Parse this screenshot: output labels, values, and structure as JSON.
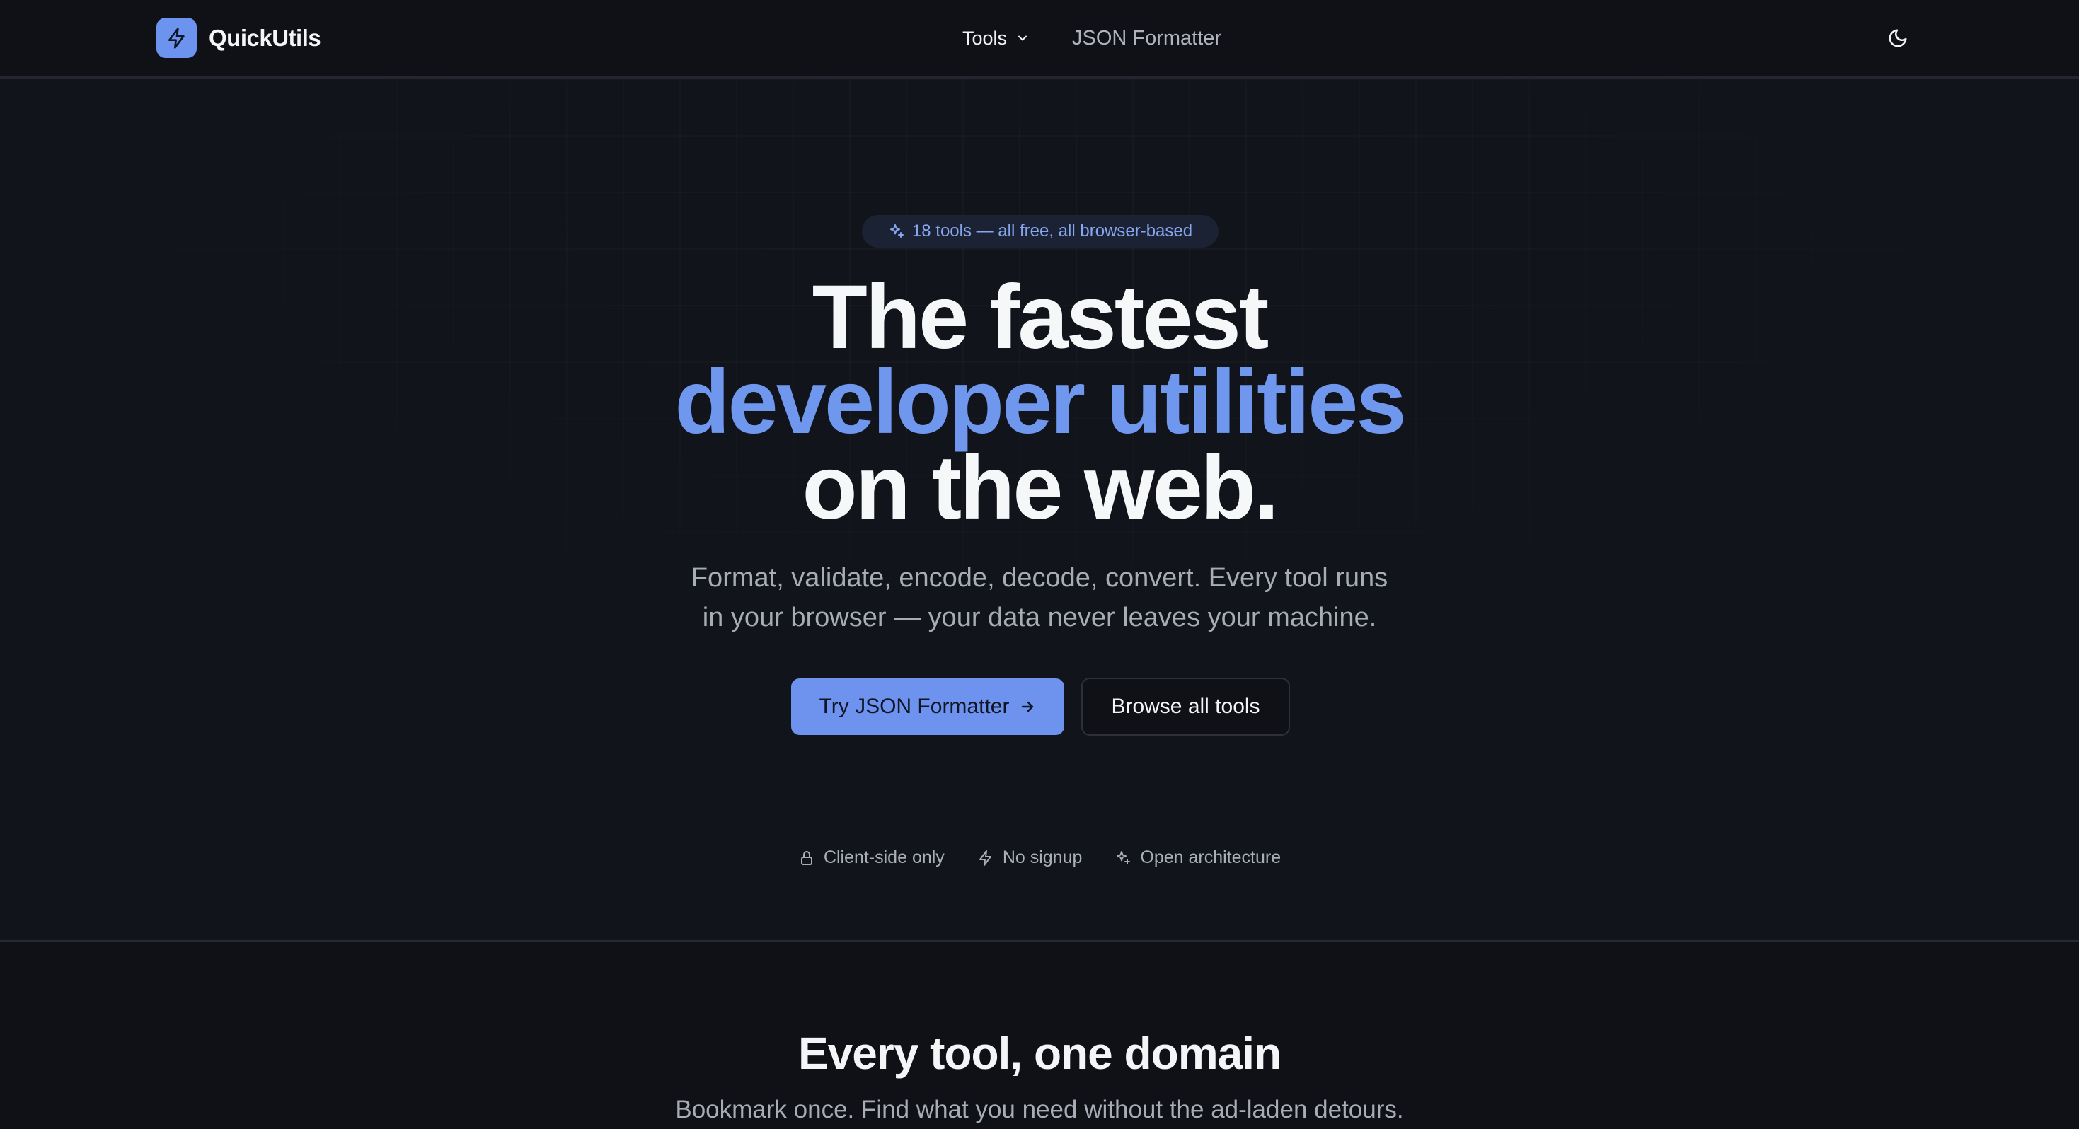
{
  "header": {
    "brand_name": "QuickUtils",
    "brand_icon": "lightning-icon",
    "nav_tools_label": "Tools",
    "nav_json_label": "JSON Formatter",
    "theme_icon": "moon-icon"
  },
  "hero": {
    "badge": "18 tools — all free, all browser-based",
    "headline_line1": "The fastest",
    "headline_line2": "developer utilities",
    "headline_line3": "on the web.",
    "subtitle_line1": "Format, validate, encode, decode, convert. Every tool runs",
    "subtitle_line2": "in your browser — your data never leaves your machine.",
    "primary_button": "Try JSON Formatter",
    "secondary_button": "Browse all tools",
    "features": [
      {
        "icon": "lock-icon",
        "label": "Client-side only"
      },
      {
        "icon": "lightning-icon",
        "label": "No signup"
      },
      {
        "icon": "sparkles-icon",
        "label": "Open architecture"
      }
    ]
  },
  "section": {
    "title": "Every tool, one domain",
    "subtitle": "Bookmark once. Find what you need without the ad-laden detours."
  },
  "colors": {
    "background": "#0f1117",
    "accent": "#6d93ee",
    "muted_text": "#a7acb7"
  }
}
